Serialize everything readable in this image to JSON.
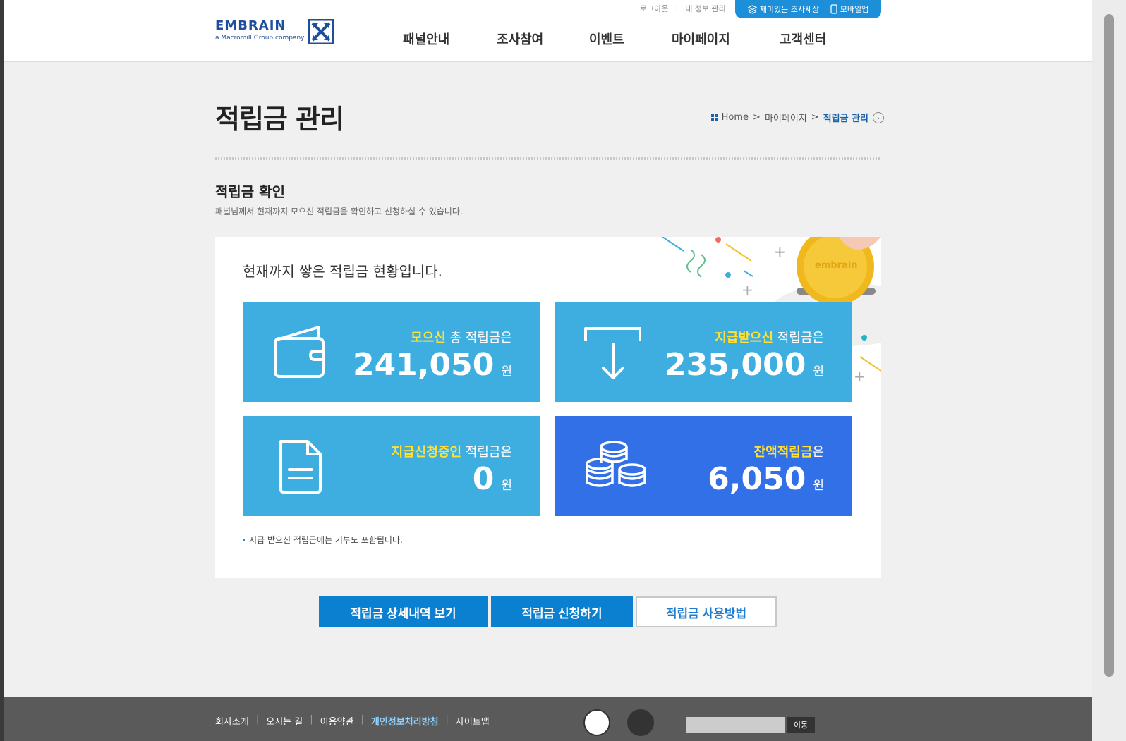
{
  "header": {
    "logo_word": "EMBRAIN",
    "logo_sub": "a Macromill Group company",
    "util_links": [
      "로그아웃",
      "내 정보 관리"
    ],
    "app_links": [
      "재미있는 조사세상",
      "모바일앱"
    ],
    "nav": [
      "패널안내",
      "조사참여",
      "이벤트",
      "마이페이지",
      "고객센터"
    ]
  },
  "page": {
    "title": "적립금 관리",
    "breadcrumb": [
      "Home",
      "마이페이지",
      "적립금 관리"
    ]
  },
  "section": {
    "title": "적립금 확인",
    "desc": "패널님께서 현재까지 모으신 적립금을 확인하고 신청하실 수 있습니다."
  },
  "card": {
    "heading": "현재까지 쌓은 적립금 현황입니다.",
    "tiles": [
      {
        "highlight": "모으신",
        "rest": " 총 적립금은",
        "amount": "241,050",
        "unit": "원",
        "icon": "wallet-icon"
      },
      {
        "highlight": "지급받으신",
        "rest": " 적립금은",
        "amount": "235,000",
        "unit": "원",
        "icon": "arrow-down-tray-icon"
      },
      {
        "highlight": "지급신청중인",
        "rest": " 적립금은",
        "amount": "0",
        "unit": "원",
        "icon": "document-icon"
      },
      {
        "highlight": "잔액적립금",
        "rest": "은",
        "amount": "6,050",
        "unit": "원",
        "icon": "coins-icon"
      }
    ],
    "note": "지급 받으신 적립금에는 기부도 포함됩니다.",
    "coin_text": "embrain"
  },
  "buttons": {
    "detail": "적립금 상세내역 보기",
    "apply": "적립금 신청하기",
    "howto": "적립금 사용방법"
  },
  "footer": {
    "links": [
      "회사소개",
      "오시는 길",
      "이용약관",
      "개인정보처리방침",
      "사이트맵"
    ],
    "go_label": "이동"
  },
  "colors": {
    "brand": "#1e4e9c",
    "tile_sky": "#3eaee0",
    "tile_blue": "#3170e6",
    "highlight": "#ffe033",
    "button": "#0b7fd0"
  }
}
